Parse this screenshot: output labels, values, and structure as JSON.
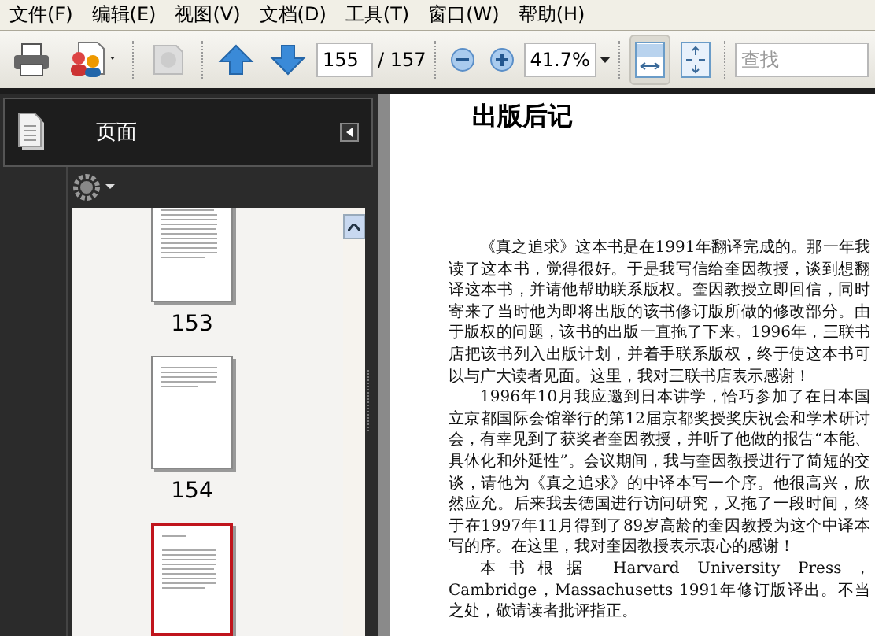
{
  "menu": [
    "文件(F)",
    "编辑(E)",
    "视图(V)",
    "文档(D)",
    "工具(T)",
    "窗口(W)",
    "帮助(H)"
  ],
  "toolbar": {
    "page": {
      "value": "155",
      "total": "/ 157"
    },
    "zoom": {
      "value": "41.7%"
    },
    "view_buttons": [
      {
        "kind": "fit_width",
        "selected": true
      },
      {
        "kind": "fit_page",
        "selected": false
      }
    ],
    "search": {
      "placeholder": "查找"
    }
  },
  "sidebar": {
    "title": "页面",
    "thumbnails": [
      {
        "label": "153",
        "selected": false,
        "kind": "full"
      },
      {
        "label": "154",
        "selected": false,
        "kind": "short"
      },
      {
        "selected": true,
        "kind": "titled"
      }
    ]
  },
  "document": {
    "title": "出版后记",
    "paragraphs": [
      "《真之追求》这本书是在1991年翻译完成的。那一年我读了这本书，觉得很好。于是我写信给奎因教授，谈到想翻译这本书，并请他帮助联系版权。奎因教授立即回信，同时寄来了当时他为即将出版的该书修订版所做的修改部分。由于版权的问题，该书的出版一直拖了下来。1996年，三联书店把该书列入出版计划，并着手联系版权，终于使这本书可以与广大读者见面。这里，我对三联书店表示感谢！",
      "1996年10月我应邀到日本讲学，恰巧参加了在日本国立京都国际会馆举行的第12届京都奖授奖庆祝会和学术研讨会，有幸见到了获奖者奎因教授，并听了他做的报告“本能、具体化和外延性”。会议期间，我与奎因教授进行了简短的交谈，请他为《真之追求》的中译本写一个序。他很高兴，欣然应允。后来我去德国进行访问研究，又拖了一段时间，终于在1997年11月得到了89岁高龄的奎因教授为这个中译本写的序。在这里，我对奎因教授表示衷心的感谢！",
      "本书根据 Harvard University Press，Cambridge，Massachusetts 1991年修订版译出。不当之处，敬请读者批评指正。"
    ]
  }
}
